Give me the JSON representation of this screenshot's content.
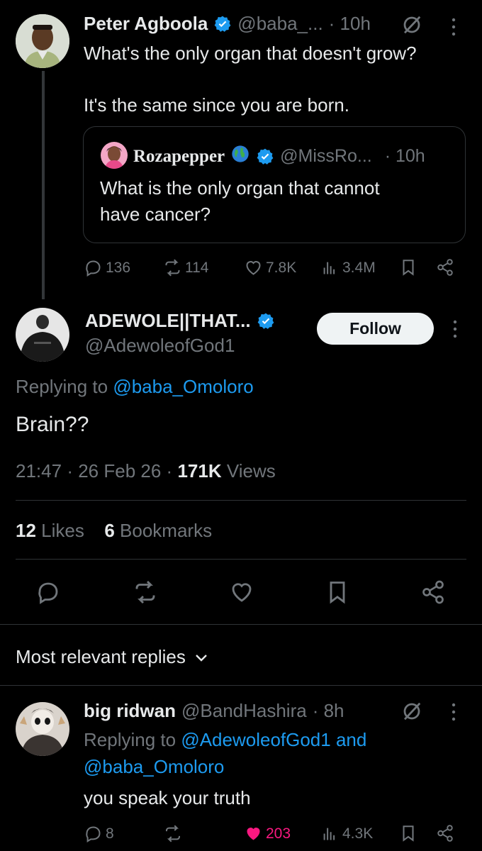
{
  "parent_tweet": {
    "author_name": "Peter Agboola",
    "handle": "@baba_...",
    "time": "· 10h",
    "text_line1": "What's the only organ that doesn't grow?",
    "text_line2": "It's the same since you are born.",
    "quoted": {
      "author_name": "Rozapepper",
      "handle": "@MissRo...",
      "time": "· 10h",
      "text_line1": "What is the only organ that cannot",
      "text_line2": "have cancer?"
    },
    "stats": {
      "replies": "136",
      "retweets": "114",
      "likes": "7.8K",
      "views": "3.4M"
    }
  },
  "main_tweet": {
    "author_name": "ADEWOLE||THAT...",
    "handle": "@AdewoleofGod1",
    "follow_label": "Follow",
    "replying_prefix": "Replying to",
    "replying_to": "@baba_Omoloro",
    "text": "Brain??",
    "time": "21:47",
    "date": "26 Feb 26",
    "views_count": "171K",
    "views_label": "Views",
    "likes_count": "12",
    "likes_label": "Likes",
    "bookmarks_count": "6",
    "bookmarks_label": "Bookmarks"
  },
  "replies_header": {
    "label": "Most relevant replies"
  },
  "reply": {
    "author_name": "big ridwan",
    "handle": "@BandHashira",
    "time": "· 8h",
    "replying_prefix": "Replying to",
    "replying_to_1": "@AdewoleofGod1",
    "replying_and": "and",
    "replying_to_2": "@baba_Omoloro",
    "text": "you speak your truth",
    "stats": {
      "replies": "8",
      "likes": "203",
      "views": "4.3K"
    }
  },
  "colors": {
    "accent": "#1d9bf0",
    "like": "#f91880",
    "muted": "#71767b",
    "text": "#e7e9ea"
  }
}
